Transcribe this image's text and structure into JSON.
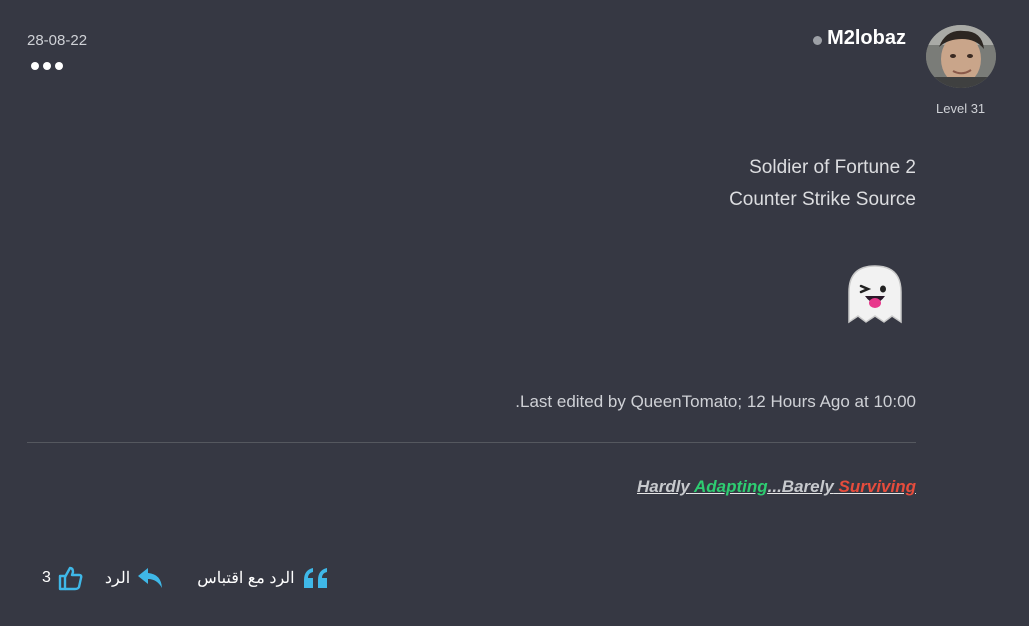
{
  "post": {
    "date": "28-08-22",
    "more_icon": "more-dots-icon",
    "user": {
      "name": "M2lobaz",
      "status": "offline",
      "status_color": "#9da0a6",
      "level": "Level 31"
    },
    "content_lines": [
      "Soldier of Fortune 2",
      "Counter Strike Source"
    ],
    "emoji": "ghost",
    "edited_note": ".Last edited by QueenTomato; 12 Hours Ago at 10:00",
    "signature": {
      "part1": "Hardly",
      "part2": "Adapting",
      "part3": "...Barely",
      "part4": "Surviving",
      "colors": {
        "white": "#c7c9cd",
        "green": "#2ecc71",
        "red": "#e74c3c"
      }
    },
    "actions": {
      "like_count": "3",
      "reply_label": "الرد",
      "quote_label": "الرد مع اقتباس",
      "accent": "#3fb8e8"
    }
  }
}
